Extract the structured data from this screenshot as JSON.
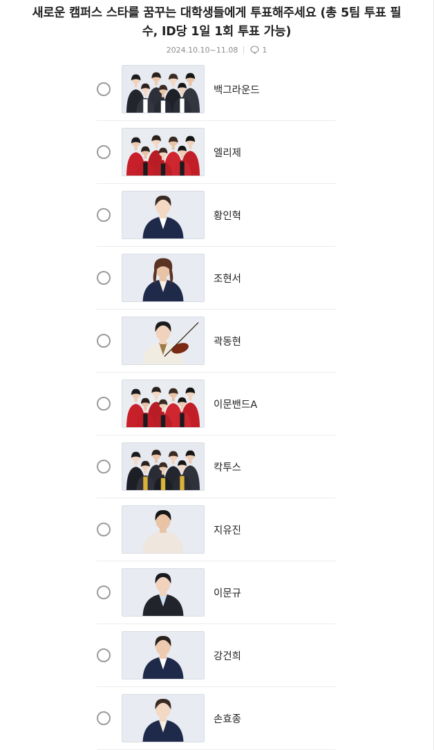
{
  "poll": {
    "title": "새로운 캠퍼스 스타를 꿈꾸는 대학생들에게 투표해주세요 (총 5팀 투표 필수, ID당 1일 1회 투표 가능)",
    "period": "2024.10.10~11.08",
    "comment_count": "1"
  },
  "options": [
    {
      "label": "백그라운드",
      "image": "group-photo"
    },
    {
      "label": "엘리제",
      "image": "group-photo"
    },
    {
      "label": "황인혁",
      "image": "solo-photo"
    },
    {
      "label": "조현서",
      "image": "solo-photo"
    },
    {
      "label": "곽동현",
      "image": "solo-photo-violin"
    },
    {
      "label": "이문밴드A",
      "image": "group-photo"
    },
    {
      "label": "칵투스",
      "image": "group-photo"
    },
    {
      "label": "지유진",
      "image": "solo-photo"
    },
    {
      "label": "이문규",
      "image": "solo-photo"
    },
    {
      "label": "강건희",
      "image": "solo-photo"
    },
    {
      "label": "손효종",
      "image": "solo-photo"
    }
  ],
  "colors": {
    "radio_border": "#9a9a9a",
    "thumb_bg": "#e8ecf2",
    "jacket_dark": "#2b2d36",
    "jacket_red": "#c8202a",
    "jacket_navy": "#1f2a4a"
  }
}
